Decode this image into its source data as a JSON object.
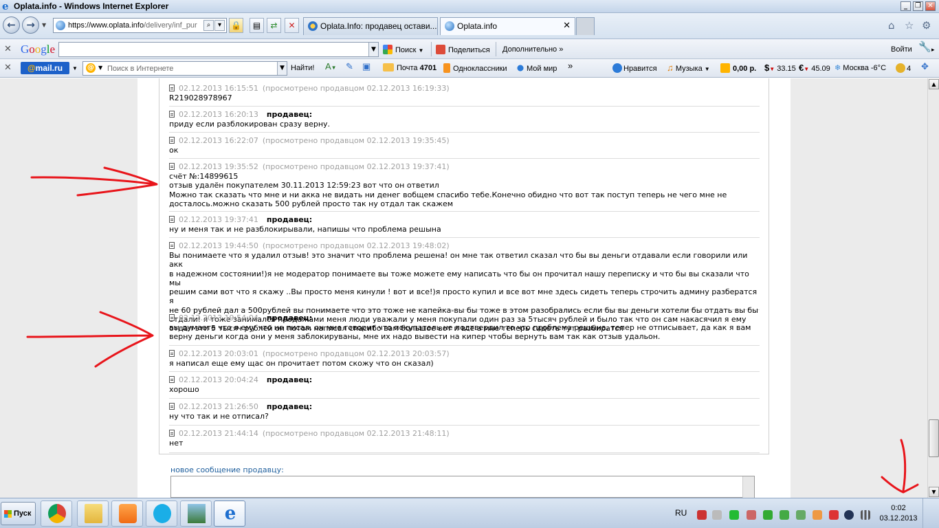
{
  "window": {
    "title": "Oplata.info - Windows Internet Explorer"
  },
  "address_bar": {
    "url_main": "https://www.oplata.info",
    "url_rest": "/delivery/inf_pur"
  },
  "tabs": [
    {
      "label": "Oplata.Info: продавец остави...",
      "active": false
    },
    {
      "label": "Oplata.info",
      "active": true
    }
  ],
  "google_toolbar": {
    "logo": "Google",
    "search_value": "",
    "search_button": "Поиск",
    "share": "Поделиться",
    "more": "Дополнительно »",
    "signin": "Войти"
  },
  "mailru_toolbar": {
    "logo_at": "@",
    "logo_text": "mail.ru",
    "search_placeholder": "Поиск в Интернете",
    "find_button": "Найти!",
    "mail_label": "Почта",
    "mail_count": "4701",
    "odnoklassniki": "Одноклассники",
    "moi_mir": "Мой мир",
    "like": "Нравится",
    "music": "Музыка",
    "balance": "0,00 р.",
    "usd": "33.15",
    "eur": "45.09",
    "weather": "Москва -6°C",
    "coins": "4"
  },
  "messages": [
    {
      "time": "02.12.2013 16:15:51",
      "seen": "(просмотрено продавцом 02.12.2013 16:19:33)",
      "seller": "",
      "text": "R219028978967"
    },
    {
      "time": "02.12.2013 16:20:13",
      "seen": "",
      "seller": "продавец:",
      "text": "приду если разблокирован сразу верну."
    },
    {
      "time": "02.12.2013 16:22:07",
      "seen": "(просмотрено продавцом 02.12.2013 19:35:45)",
      "seller": "",
      "text": "ок"
    },
    {
      "time": "02.12.2013 19:35:52",
      "seen": "(просмотрено продавцом 02.12.2013 19:37:41)",
      "seller": "",
      "text": "счёт №:14899615\nотзыв удалён покупателем 30.11.2013 12:59:23 вот что он ответил\nМожно так сказать что мне и ни акка не видать ни денег вобщем спасибо тебе.Конечно обидно что вот так поступ теперь не чего мне не\nдосталось.можно сказать 500 рублей просто так ну отдал так скажем"
    },
    {
      "time": "02.12.2013 19:37:41",
      "seen": "",
      "seller": "продавец:",
      "text": "ну и меня так и не разблокирывали, напишы что проблема решына"
    },
    {
      "time": "02.12.2013 19:44:50",
      "seen": "(просмотрено продавцом 02.12.2013 19:48:02)",
      "seller": "",
      "text": "Вы понимаете что я удалил отзыв! это значит что проблема решена! он мне так ответил сказал что бы вы деньги отдавали если говорили или акк\nв надежном состоянии!)я не модератор понимаете вы тоже можете ему написать что бы он прочитал нашу переписку и что бы вы сказали что мы\nрешим сами вот что я скажу ..Вы просто меня кинули ! вот и все!)я просто купил и все вот мне здесь сидеть теперь строчить админу разберaтся я\nне 60 рублей дал а 500рублей вы понимаете что это тоже не капейка-вы бы тоже в этом разобрались если бы вы деньги хотели бы отдать вы бы\nотдали! я тоже занимался продажами меня люди уважали у меня покупали один раз за 5тысяч рублей и было так что он сам накасячил я ему\nотдал эти 5 тысяч рублей он потом написал спасибо вам большое вот и все а мне теперь сидеть тут разбиратся"
    },
    {
      "time": "02.12.2013 19:54:04",
      "seen": "",
      "seller": "продавец:",
      "text": "вы думаете что я ему что не писал, он мне говорит что покупатель не подтвердил то что проблема решына, тепер не отписывает, да как я вам\nверну деньги когда они у меня заблокируваны, мне их надо вывести на кипер чтобы вернуть вам так как отзыв удальон."
    },
    {
      "time": "02.12.2013 20:03:01",
      "seen": "(просмотрено продавцом 02.12.2013 20:03:57)",
      "seller": "",
      "text": "я написал еще ему щас он прочитает потом скожу что он сказал)"
    },
    {
      "time": "02.12.2013 20:04:24",
      "seen": "",
      "seller": "продавец:",
      "text": "хорошо"
    },
    {
      "time": "02.12.2013 21:26:50",
      "seen": "",
      "seller": "продавец:",
      "text": "ну что так и не отписал?"
    },
    {
      "time": "02.12.2013 21:44:14",
      "seen": "(просмотрено продавцом 02.12.2013 21:48:11)",
      "seller": "",
      "text": "нет"
    }
  ],
  "new_message": {
    "label": "новое сообщение продавцу:",
    "value": ""
  },
  "taskbar": {
    "start": "Пуск",
    "lang": "RU",
    "time": "0:02",
    "date": "03.12.2013"
  },
  "colors": {
    "timestamp_gray": "#a0a0a0",
    "link_blue": "#1e5e9c",
    "annotation_red": "#e8151b"
  }
}
